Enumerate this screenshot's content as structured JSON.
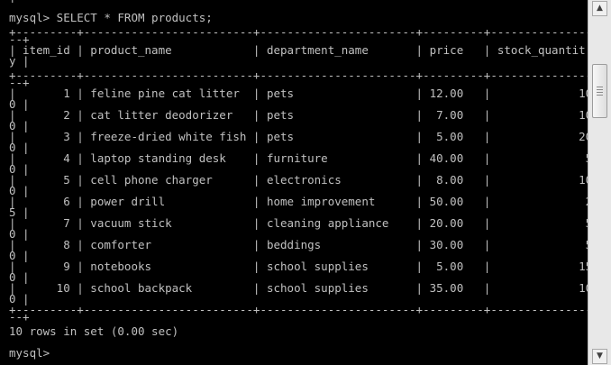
{
  "terminal": {
    "lines": [
      "| ",
      "mysql> SELECT * FROM products;",
      "+---------+-------------------------+-----------------------+---------+---------------",
      "--+",
      "| item_id | product_name            | department_name       | price   | stock_quantit",
      "y |",
      "+---------+-------------------------+-----------------------+---------+---------------",
      "--+",
      "|       1 | feline pine cat litter  | pets                  | 12.00   |             10",
      "0 |",
      "|       2 | cat litter deodorizer   | pets                  |  7.00   |             10",
      "0 |",
      "|       3 | freeze-dried white fish | pets                  |  5.00   |             20",
      "0 |",
      "|       4 | laptop standing desk    | furniture             | 40.00   |              5",
      "0 |",
      "|       5 | cell phone charger      | electronics           |  8.00   |             10",
      "0 |",
      "|       6 | power drill             | home improvement      | 50.00   |              2",
      "5 |",
      "|       7 | vacuum stick            | cleaning appliance    | 20.00   |              5",
      "0 |",
      "|       8 | comforter               | beddings              | 30.00   |              5",
      "0 |",
      "|       9 | notebooks               | school supplies       |  5.00   |             15",
      "0 |",
      "|      10 | school backpack         | school supplies       | 35.00   |             10",
      "0 |",
      "+---------+-------------------------+-----------------------+---------+---------------",
      "--+",
      "10 rows in set (0.00 sec)",
      "",
      "mysql>"
    ]
  },
  "scrollbar": {
    "up_icon": "▲",
    "down_icon": "▼",
    "scroll_position": 0.95
  }
}
